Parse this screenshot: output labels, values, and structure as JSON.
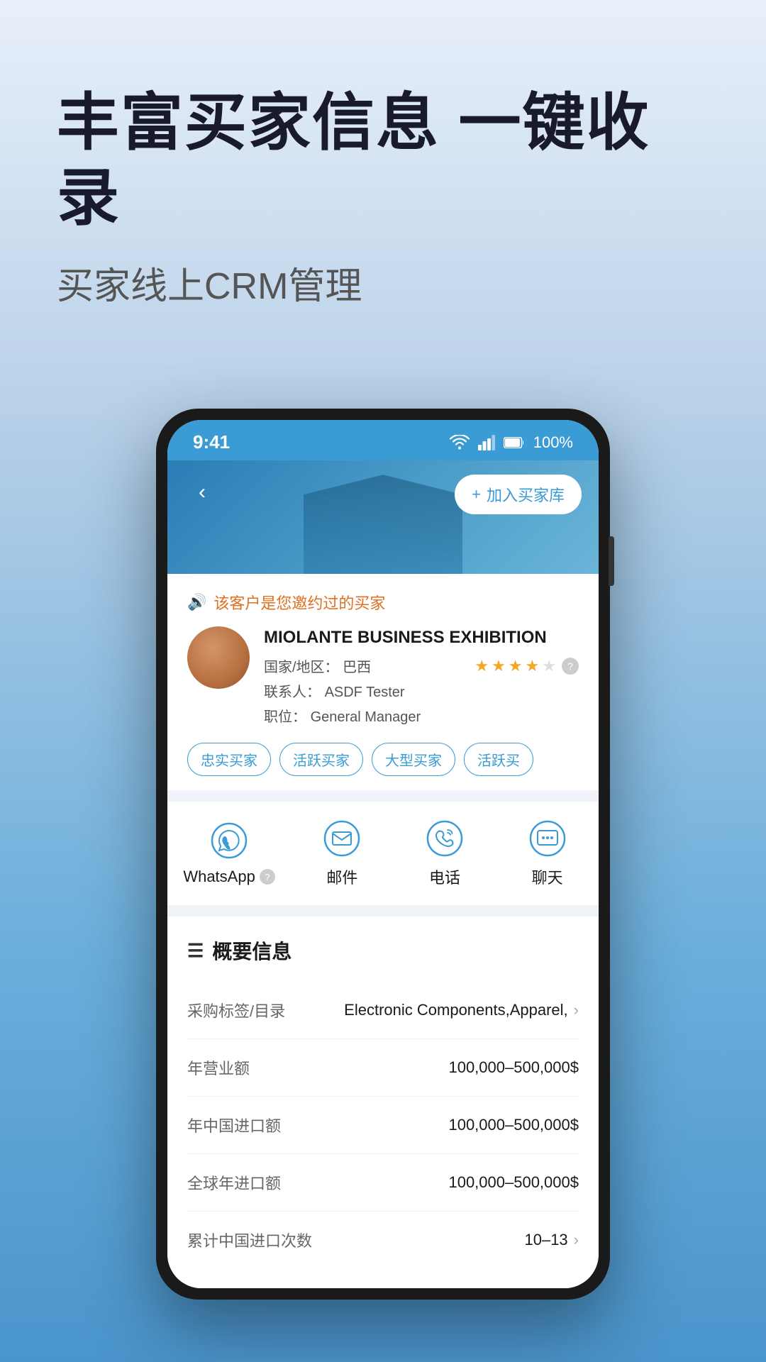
{
  "page": {
    "bg_gradient_start": "#e8f0fa",
    "bg_gradient_end": "#4a95cc"
  },
  "hero": {
    "title": "丰富买家信息 一键收录",
    "subtitle": "买家线上CRM管理"
  },
  "phone": {
    "status_bar": {
      "time": "9:41",
      "battery": "100%"
    },
    "header": {
      "back_label": "‹",
      "add_btn_icon": "+",
      "add_btn_label": "加入买家库"
    },
    "alert": {
      "text": "该客户是您邀约过的买家"
    },
    "customer": {
      "company": "MIOLANTE BUSINESS EXHIBITION",
      "country_label": "国家/地区：",
      "country_value": "巴西",
      "contact_label": "联系人：",
      "contact_value": "ASDF Tester",
      "position_label": "职位：",
      "position_value": "General Manager",
      "stars_filled": 4,
      "stars_empty": 1,
      "tags": [
        "忠实买家",
        "活跃买家",
        "大型买家",
        "活跃买"
      ]
    },
    "actions": [
      {
        "label": "WhatsApp",
        "has_help": true,
        "icon": "whatsapp"
      },
      {
        "label": "邮件",
        "has_help": false,
        "icon": "email"
      },
      {
        "label": "电话",
        "has_help": false,
        "icon": "phone"
      },
      {
        "label": "聊天",
        "has_help": false,
        "icon": "chat"
      }
    ],
    "info_section": {
      "title": "概要信息",
      "rows": [
        {
          "key": "采购标签/目录",
          "value": "Electronic Components,Apparel,",
          "has_chevron": true
        },
        {
          "key": "年营业额",
          "value": "100,000–500,000$",
          "has_chevron": false
        },
        {
          "key": "年中国进口额",
          "value": "100,000–500,000$",
          "has_chevron": false
        },
        {
          "key": "全球年进口额",
          "value": "100,000–500,000$",
          "has_chevron": false
        },
        {
          "key": "累计中国进口次数",
          "value": "10–13",
          "has_chevron": true
        }
      ]
    }
  }
}
